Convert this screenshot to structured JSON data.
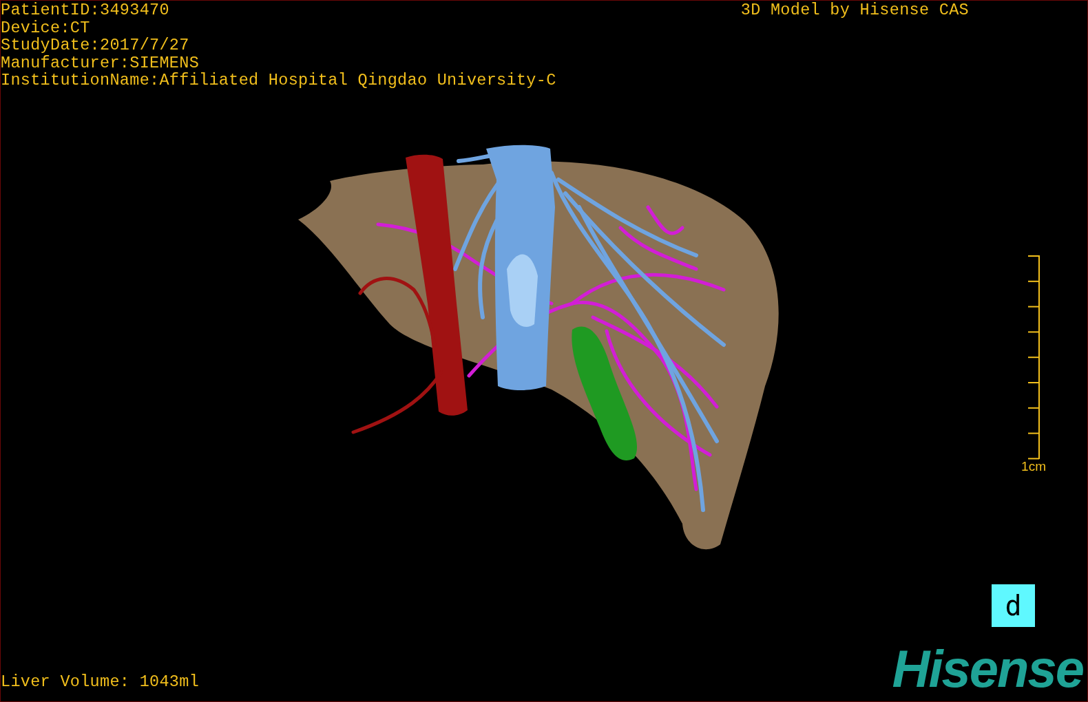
{
  "patient_info": [
    "PatientID:3493470",
    "Device:CT",
    "StudyDate:2017/7/27",
    "Manufacturer:SIEMENS",
    "InstitutionName:Affiliated Hospital Qingdao University-C"
  ],
  "title": "3D Model by Hisense CAS",
  "scale_bar": {
    "label": "1cm"
  },
  "orientation_marker": {
    "label": "d"
  },
  "liver_volume": "Liver Volume: 1043ml",
  "logo": "Hisense"
}
